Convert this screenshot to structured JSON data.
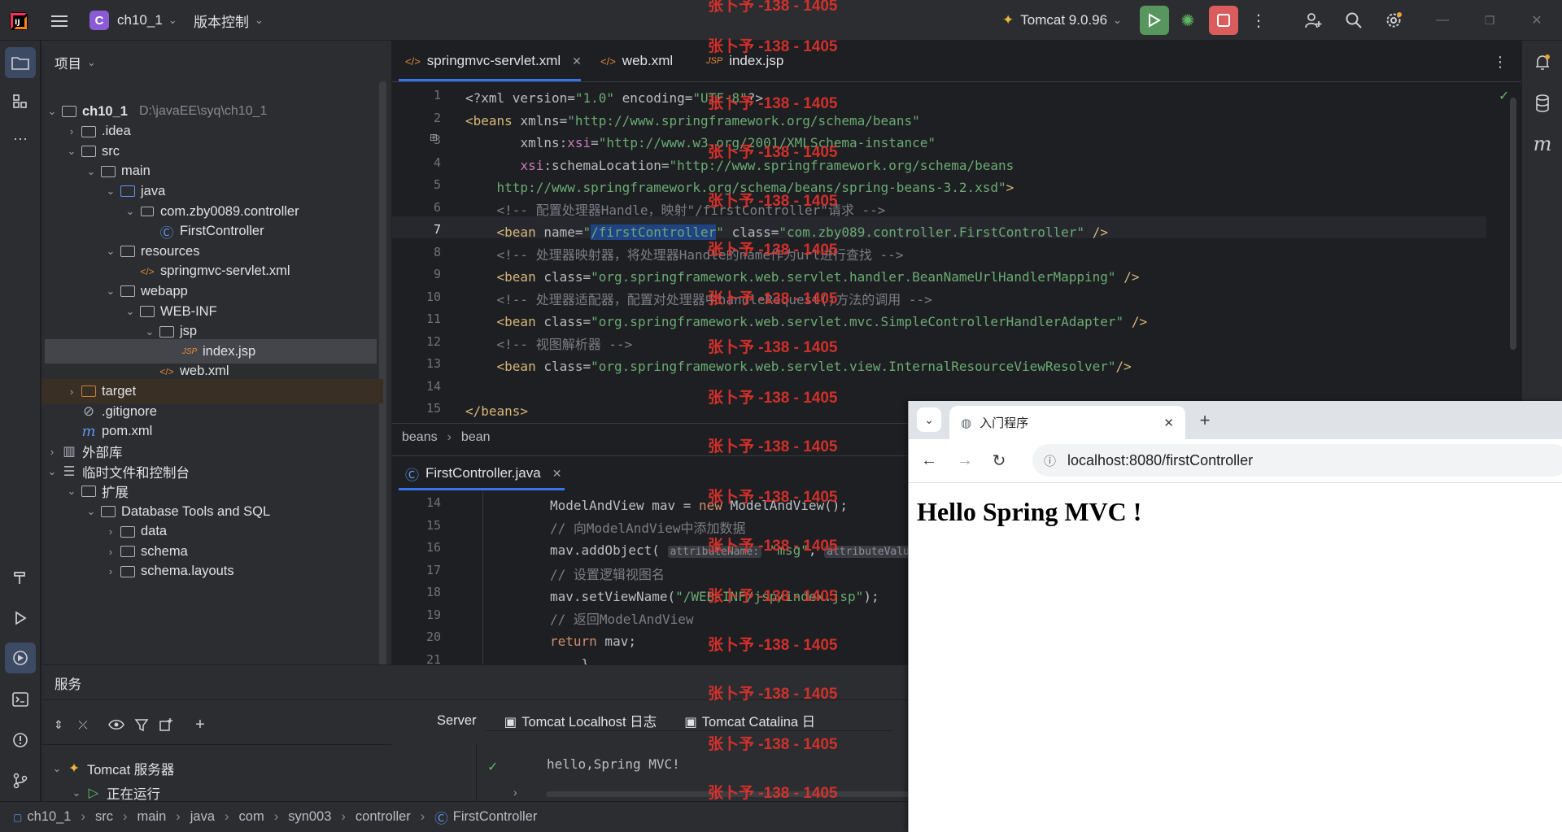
{
  "titlebar": {
    "project_badge": "C",
    "project_name": "ch10_1",
    "vcs_label": "版本控制",
    "run_config": "Tomcat 9.0.96"
  },
  "project_panel": {
    "title": "项目",
    "tree": [
      {
        "label": "ch10_1",
        "path": "D:\\javaEE\\syq\\ch10_1",
        "icon": "module-folder-icon"
      },
      {
        "label": ".idea",
        "icon": "folder-icon"
      },
      {
        "label": "src",
        "icon": "folder-icon"
      },
      {
        "label": "main",
        "icon": "folder-icon"
      },
      {
        "label": "java",
        "icon": "source-folder-icon"
      },
      {
        "label": "com.zby0089.controller",
        "icon": "package-icon"
      },
      {
        "label": "FirstController",
        "icon": "class-icon"
      },
      {
        "label": "resources",
        "icon": "resources-folder-icon"
      },
      {
        "label": "springmvc-servlet.xml",
        "icon": "xml-file-icon"
      },
      {
        "label": "webapp",
        "icon": "folder-icon"
      },
      {
        "label": "WEB-INF",
        "icon": "folder-icon"
      },
      {
        "label": "jsp",
        "icon": "folder-icon"
      },
      {
        "label": "index.jsp",
        "icon": "jsp-file-icon"
      },
      {
        "label": "web.xml",
        "icon": "xml-file-icon"
      },
      {
        "label": "target",
        "icon": "excluded-folder-icon"
      },
      {
        "label": ".gitignore",
        "icon": "gitignore-icon"
      },
      {
        "label": "pom.xml",
        "icon": "maven-icon"
      },
      {
        "label": "外部库",
        "icon": "library-icon"
      },
      {
        "label": "临时文件和控制台",
        "icon": "scratch-icon"
      },
      {
        "label": "扩展",
        "icon": "folder-icon"
      },
      {
        "label": "Database Tools and SQL",
        "icon": "folder-icon"
      },
      {
        "label": "data",
        "icon": "folder-icon"
      },
      {
        "label": "schema",
        "icon": "folder-icon"
      },
      {
        "label": "schema.layouts",
        "icon": "folder-icon"
      }
    ]
  },
  "editor_top": {
    "tabs": [
      "springmvc-servlet.xml",
      "web.xml",
      "index.jsp"
    ],
    "line_numbers": [
      "1",
      "2",
      "3",
      "4",
      "5",
      "6",
      "7",
      "8",
      "9",
      "10",
      "11",
      "12",
      "13",
      "14",
      "15"
    ],
    "breadcrumb": [
      "beans",
      "bean"
    ]
  },
  "editor_bottom": {
    "tab": "FirstController.java",
    "line_numbers": [
      "14",
      "15",
      "16",
      "17",
      "18",
      "19",
      "20",
      "21"
    ]
  },
  "services": {
    "title": "服务",
    "tree": [
      "Tomcat 服务器",
      "正在运行"
    ],
    "tabs": [
      "Server",
      "Tomcat Localhost 日志",
      "Tomcat Catalina 日"
    ],
    "output": "hello,Spring MVC!"
  },
  "statusbar": {
    "crumbs": [
      "ch10_1",
      "src",
      "main",
      "java",
      "com",
      "syn003",
      "controller",
      "FirstController"
    ]
  },
  "browser": {
    "tab_title": "入门程序",
    "url": "localhost:8080/firstController",
    "heading": "Hello Spring MVC !"
  },
  "watermark": "张卜予 -138 - 1405"
}
